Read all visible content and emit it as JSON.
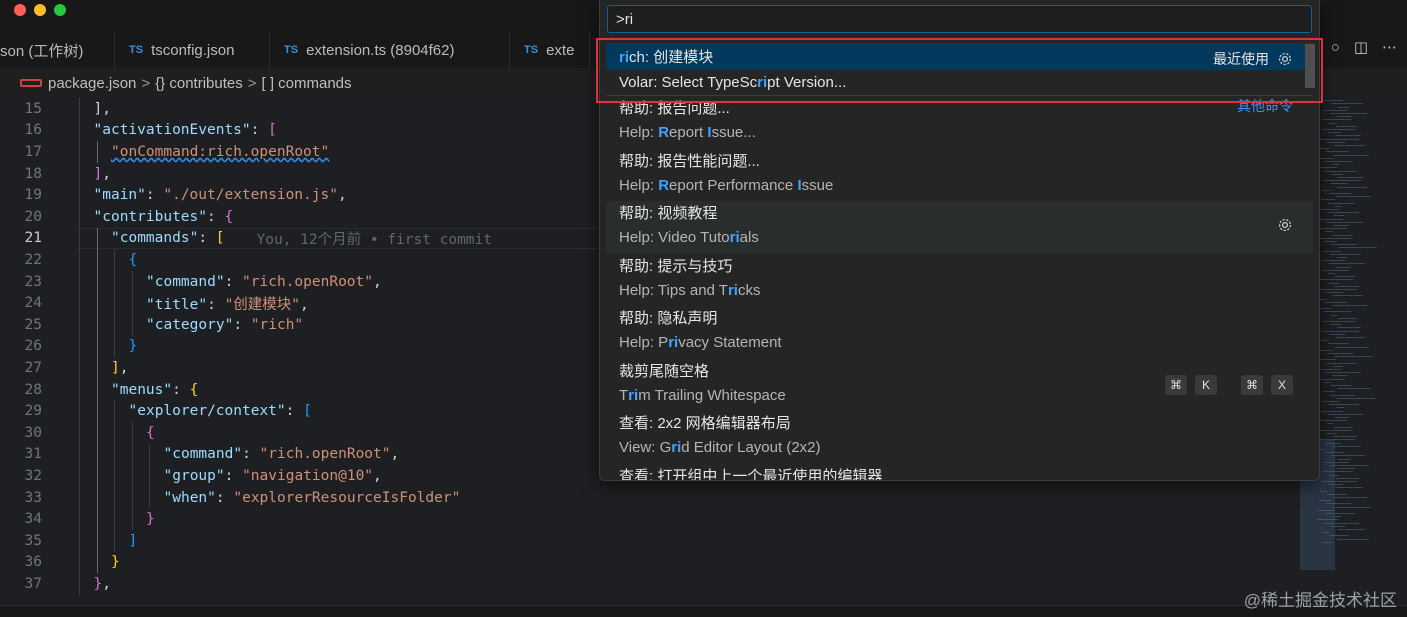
{
  "tabs": [
    {
      "label": "son (工作树)",
      "kind": "json"
    },
    {
      "label": "tsconfig.json",
      "kind": "ts",
      "badge": "TS"
    },
    {
      "label": "extension.ts (8904f62)",
      "kind": "ts",
      "badge": "TS"
    },
    {
      "label": "exte",
      "kind": "ts",
      "badge": "TS"
    }
  ],
  "breadcrumb": {
    "file": "package.json",
    "sep": ">",
    "p1": "{} contributes",
    "p2": "[ ] commands"
  },
  "editor": {
    "lines": [
      {
        "n": "15",
        "html": "<span class='p'>],</span>",
        "indent": 2
      },
      {
        "n": "16",
        "html": "<span class='k'>\"activationEvents\"</span><span class='p'>: </span><span class='b1'>[</span>",
        "indent": 2
      },
      {
        "n": "17",
        "html": "<span class='s squiggle'>\"onCommand:rich.openRoot\"</span>",
        "indent": 3
      },
      {
        "n": "18",
        "html": "<span class='b1'>]</span><span class='p'>,</span>",
        "indent": 2
      },
      {
        "n": "19",
        "html": "<span class='k'>\"main\"</span><span class='p'>: </span><span class='s'>\"./out/extension.js\"</span><span class='p'>,</span>",
        "indent": 2
      },
      {
        "n": "20",
        "html": "<span class='k'>\"contributes\"</span><span class='p'>: </span><span class='b1'>{</span>",
        "indent": 2
      },
      {
        "n": "21",
        "html": "<span class='k'>\"commands\"</span><span class='p'>: </span><span class='b2'>[</span>",
        "indent": 3,
        "active": true,
        "blame": "You, 12个月前 • first commit"
      },
      {
        "n": "22",
        "html": "<span class='b3'>{</span>",
        "indent": 4
      },
      {
        "n": "23",
        "html": "<span class='k'>\"command\"</span><span class='p'>: </span><span class='s'>\"rich.openRoot\"</span><span class='p'>,</span>",
        "indent": 5
      },
      {
        "n": "24",
        "html": "<span class='k'>\"title\"</span><span class='p'>: </span><span class='s'>\"创建模块\"</span><span class='p'>,</span>",
        "indent": 5
      },
      {
        "n": "25",
        "html": "<span class='k'>\"category\"</span><span class='p'>: </span><span class='s'>\"rich\"</span>",
        "indent": 5
      },
      {
        "n": "26",
        "html": "<span class='b3'>}</span>",
        "indent": 4
      },
      {
        "n": "27",
        "html": "<span class='b2'>]</span><span class='p'>,</span>",
        "indent": 3
      },
      {
        "n": "28",
        "html": "<span class='k'>\"menus\"</span><span class='p'>: </span><span class='b2'>{</span>",
        "indent": 3
      },
      {
        "n": "29",
        "html": "<span class='k'>\"explorer/context\"</span><span class='p'>: </span><span class='b3'>[</span>",
        "indent": 4
      },
      {
        "n": "30",
        "html": "<span class='b1'>{</span>",
        "indent": 5
      },
      {
        "n": "31",
        "html": "<span class='k'>\"command\"</span><span class='p'>: </span><span class='s'>\"rich.openRoot\"</span><span class='p'>,</span>",
        "indent": 6
      },
      {
        "n": "32",
        "html": "<span class='k'>\"group\"</span><span class='p'>: </span><span class='s'>\"navigation@10\"</span><span class='p'>,</span>",
        "indent": 6
      },
      {
        "n": "33",
        "html": "<span class='k'>\"when\"</span><span class='p'>: </span><span class='s'>\"explorerResourceIsFolder\"</span>",
        "indent": 6
      },
      {
        "n": "34",
        "html": "<span class='b1'>}</span>",
        "indent": 5
      },
      {
        "n": "35",
        "html": "<span class='b3'>]</span>",
        "indent": 4
      },
      {
        "n": "36",
        "html": "<span class='b2'>}</span>",
        "indent": 3
      },
      {
        "n": "37",
        "html": "<span class='b1'>}</span><span class='p'>,</span>",
        "indent": 2
      }
    ]
  },
  "palette": {
    "input_value": ">ri",
    "items": [
      {
        "type": "one",
        "label_html": "<span class='hl'>ri</span>ch: 创建模块",
        "right": "最近使用",
        "gear": true,
        "selected": true
      },
      {
        "type": "one",
        "label_html": "Volar: Select TypeSc<span class='hl'>ri</span>pt Version..."
      },
      {
        "type": "two",
        "label": "帮助: 报告问题...",
        "sub_html": "Help: <span class='hl'>R</span>eport <span class='hl'>I</span>ssue...",
        "right_link": "其他命令"
      },
      {
        "type": "two",
        "label": "帮助: 报告性能问题...",
        "sub_html": "Help: <span class='hl'>R</span>eport Performance <span class='hl'>I</span>ssue"
      },
      {
        "type": "two",
        "label": "帮助: 视频教程",
        "sub_html": "Help: Video Tuto<span class='hl'>ri</span>als",
        "gear": true,
        "hover": true
      },
      {
        "type": "two",
        "label": "帮助: 提示与技巧",
        "sub_html": "Help: Tips and T<span class='hl'>ri</span>cks"
      },
      {
        "type": "two",
        "label": "帮助: 隐私声明",
        "sub_html": "Help: P<span class='hl'>ri</span>vacy Statement"
      },
      {
        "type": "two",
        "label": "裁剪尾随空格",
        "sub_html": "T<span class='hl'>ri</span>m Trailing Whitespace",
        "keys": [
          "⌘",
          "K",
          "⌘",
          "X"
        ]
      },
      {
        "type": "two",
        "label": "查看: 2x2 网格编辑器布局",
        "sub_html": "View: G<span class='hl'>ri</span>d Editor Layout (2x2)"
      },
      {
        "type": "two",
        "label": "查看: 打开组中上一个最近使用的编辑器",
        "sub_html": ""
      }
    ]
  },
  "watermark": "@稀土掘金技术社区",
  "colors": {
    "accent": "#3fa3ff",
    "selection": "#04395e",
    "annotation": "#e0303a"
  }
}
